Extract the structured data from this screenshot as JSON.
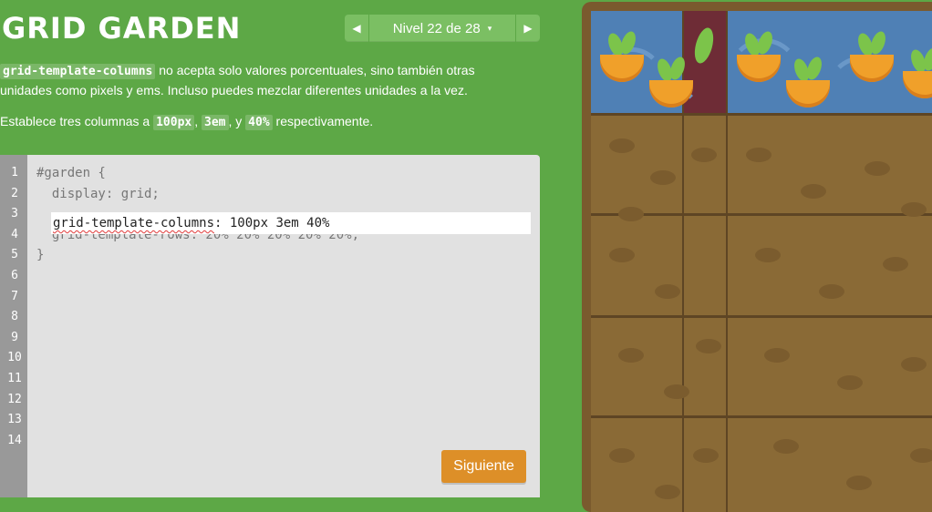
{
  "header": {
    "title": "GRID GARDEN"
  },
  "level_nav": {
    "prev_icon": "arrow-left-icon",
    "next_icon": "arrow-right-icon",
    "label": "Nivel 22 de 28",
    "caret": "▾"
  },
  "instructions": {
    "p1_code": "grid-template-columns",
    "p1_text": " no acepta solo valores porcentuales, sino también otras unidades como pixels y ems. Incluso puedes mezclar diferentes unidades a la vez.",
    "p2_prefix": "Establece tres columnas a ",
    "p2_code1": "100px",
    "p2_sep1": ", ",
    "p2_code2": "3em",
    "p2_sep2": ", y ",
    "p2_code3": "40%",
    "p2_suffix": " respectivamente."
  },
  "editor": {
    "line_numbers": [
      "1",
      "2",
      "3",
      "4",
      "5",
      "6",
      "7",
      "8",
      "9",
      "10",
      "11",
      "12",
      "13",
      "14"
    ],
    "line1": "#garden {",
    "line2": "  display: grid;",
    "input_property": "grid-template-columns",
    "input_rest": ": 100px 3em 40%",
    "line4": "  grid-template-rows: 20% 20% 20% 20% 20%;",
    "line5": "}",
    "next_button": "Siguiente"
  },
  "colors": {
    "background": "#5da846",
    "editor_bg": "#e1e1e1",
    "button": "#dd8f28",
    "soil": "#8a6a36",
    "water": "#4f80b5",
    "poison": "#6e2c36",
    "carrot": "#f0a02a"
  }
}
